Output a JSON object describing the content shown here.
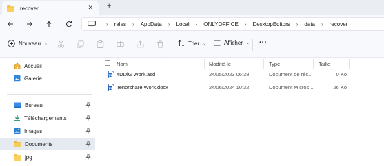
{
  "window": {
    "tab_title": "recover",
    "new_tab_symbol": "+",
    "close_symbol": "✕"
  },
  "nav": {
    "breadcrumbs": [
      "rales",
      "AppData",
      "Local",
      "ONLYOFFICE",
      "DesktopEditors",
      "data",
      "recover"
    ]
  },
  "toolbar": {
    "new_label": "Nouveau",
    "sort_label": "Trier",
    "view_label": "Afficher",
    "more_symbol": "···"
  },
  "sidebar": {
    "items": [
      {
        "label": "Accueil",
        "icon": "home-icon"
      },
      {
        "label": "Galerie",
        "icon": "gallery-icon"
      },
      {
        "label": "Bureau",
        "icon": "desktop-folder-icon",
        "pinned": true
      },
      {
        "label": "Téléchargements",
        "icon": "download-icon",
        "pinned": true
      },
      {
        "label": "Images",
        "icon": "images-icon",
        "pinned": true
      },
      {
        "label": "Documents",
        "icon": "documents-icon",
        "pinned": true,
        "selected": true
      },
      {
        "label": "jpg",
        "icon": "folder-icon",
        "pinned": true
      }
    ]
  },
  "columns": {
    "name": "Nom",
    "modified": "Modifié le",
    "type": "Type",
    "size": "Taille"
  },
  "files": [
    {
      "name": "4DDiG Work.asd",
      "modified": "24/05/2023 06:38",
      "type": "Document de réc...",
      "size": "0 Ko",
      "icon": "asd-file-icon"
    },
    {
      "name": "Tenorshare Work.docx",
      "modified": "24/06/2024 10:32",
      "type": "Document Micros...",
      "size": "26 Ko",
      "icon": "word-file-icon"
    }
  ],
  "colors": {
    "chrome_bg": "#f7f9fc",
    "tabbar_bg": "#eaeef3",
    "folder_yellow": "#f4c542",
    "accent_blue": "#1e6fd9",
    "selected_bg": "#e5eaf1"
  }
}
